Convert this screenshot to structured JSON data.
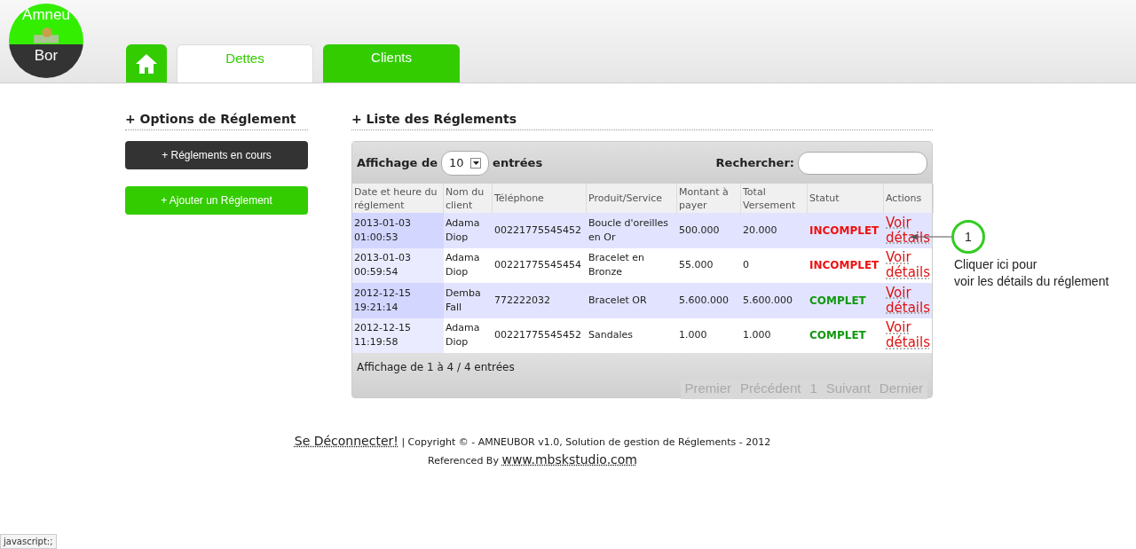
{
  "logo": {
    "top": "Amneu",
    "bottom": "Bor"
  },
  "tabs": [
    {
      "kind": "home",
      "selected": false
    },
    {
      "kind": "text",
      "label": "Dettes",
      "selected": true
    },
    {
      "kind": "text",
      "label": "Clients",
      "selected": false
    }
  ],
  "options": {
    "title": "+ Options de Réglement",
    "buttons": [
      {
        "label": "+ Réglements en cours",
        "kind": "dark"
      },
      {
        "label": "+ Ajouter un Réglement",
        "kind": "green"
      }
    ]
  },
  "list": {
    "title": "+ Liste des Réglements",
    "show_label": "Affichage de",
    "page_size": "10",
    "entries_label": "entrées",
    "search_label": "Rechercher:",
    "columns": [
      "Date et heure du réglement",
      "Nom du client",
      "Téléphone",
      "Produit/Service",
      "Montant à payer",
      "Total Versement",
      "Statut",
      "Actions"
    ],
    "rows": [
      {
        "date": "2013-01-03 01:00:53",
        "client": "Adama Diop",
        "phone": "00221775545452",
        "product": "Boucle d'oreilles en Or",
        "amount": "500.000",
        "paid": "20.000",
        "status": "INCOMPLET",
        "color": "#ee1111",
        "action": "Voir détails"
      },
      {
        "date": "2013-01-03 00:59:54",
        "client": "Adama Diop",
        "phone": "00221775545454",
        "product": "Bracelet en Bronze",
        "amount": "55.000",
        "paid": "0",
        "status": "INCOMPLET",
        "color": "#ee1111",
        "action": "Voir détails"
      },
      {
        "date": "2012-12-15 19:21:14",
        "client": "Demba Fall",
        "phone": "772222032",
        "product": "Bracelet OR",
        "amount": "5.600.000",
        "paid": "5.600.000",
        "status": "COMPLET",
        "color": "#119911",
        "action": "Voir détails"
      },
      {
        "date": "2012-12-15 11:19:58",
        "client": "Adama Diop",
        "phone": "00221775545452",
        "product": "Sandales",
        "amount": "1.000",
        "paid": "1.000",
        "status": "COMPLET",
        "color": "#119911",
        "action": "Voir détails"
      }
    ],
    "info": "Affichage de 1 à 4 / 4 entrées",
    "pagination": [
      "Premier",
      "Précédent",
      "1",
      "Suivant",
      "Dernier"
    ]
  },
  "callout": {
    "number": "1",
    "text_lines": [
      "Cliquer ici pour",
      "voir les détails du réglement"
    ]
  },
  "footer": {
    "logout": "Se Déconnecter!",
    "copyright": "| Copyright © - AMNEUBOR v1.0, Solution de gestion de Réglements - 2012",
    "ref_label": "Referenced By",
    "ref_link": "www.mbskstudio.com"
  },
  "status_bar": "javascript:;"
}
